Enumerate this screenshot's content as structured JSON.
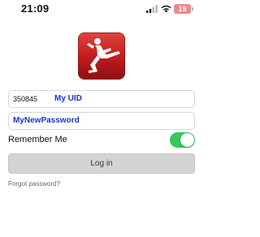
{
  "status_bar": {
    "time": "21:09",
    "battery_level": "19",
    "battery_color": "#ea8a8a",
    "icons": [
      "signal-icon",
      "wifi-icon",
      "battery-icon"
    ]
  },
  "app": {
    "logo_icon": "karate-kick-logo",
    "logo_color": "#c31d1d"
  },
  "login": {
    "uid_value": "350845",
    "uid_note": "My UID",
    "password_value": "MyNewPassword",
    "remember_label": "Remember Me",
    "remember_on": true,
    "login_label": "Log in",
    "forgot_label": "Forgot password?"
  },
  "colors": {
    "accent_text": "#1c36c9",
    "toggle_on": "#34c759",
    "button_bg": "#d4d4d4"
  }
}
